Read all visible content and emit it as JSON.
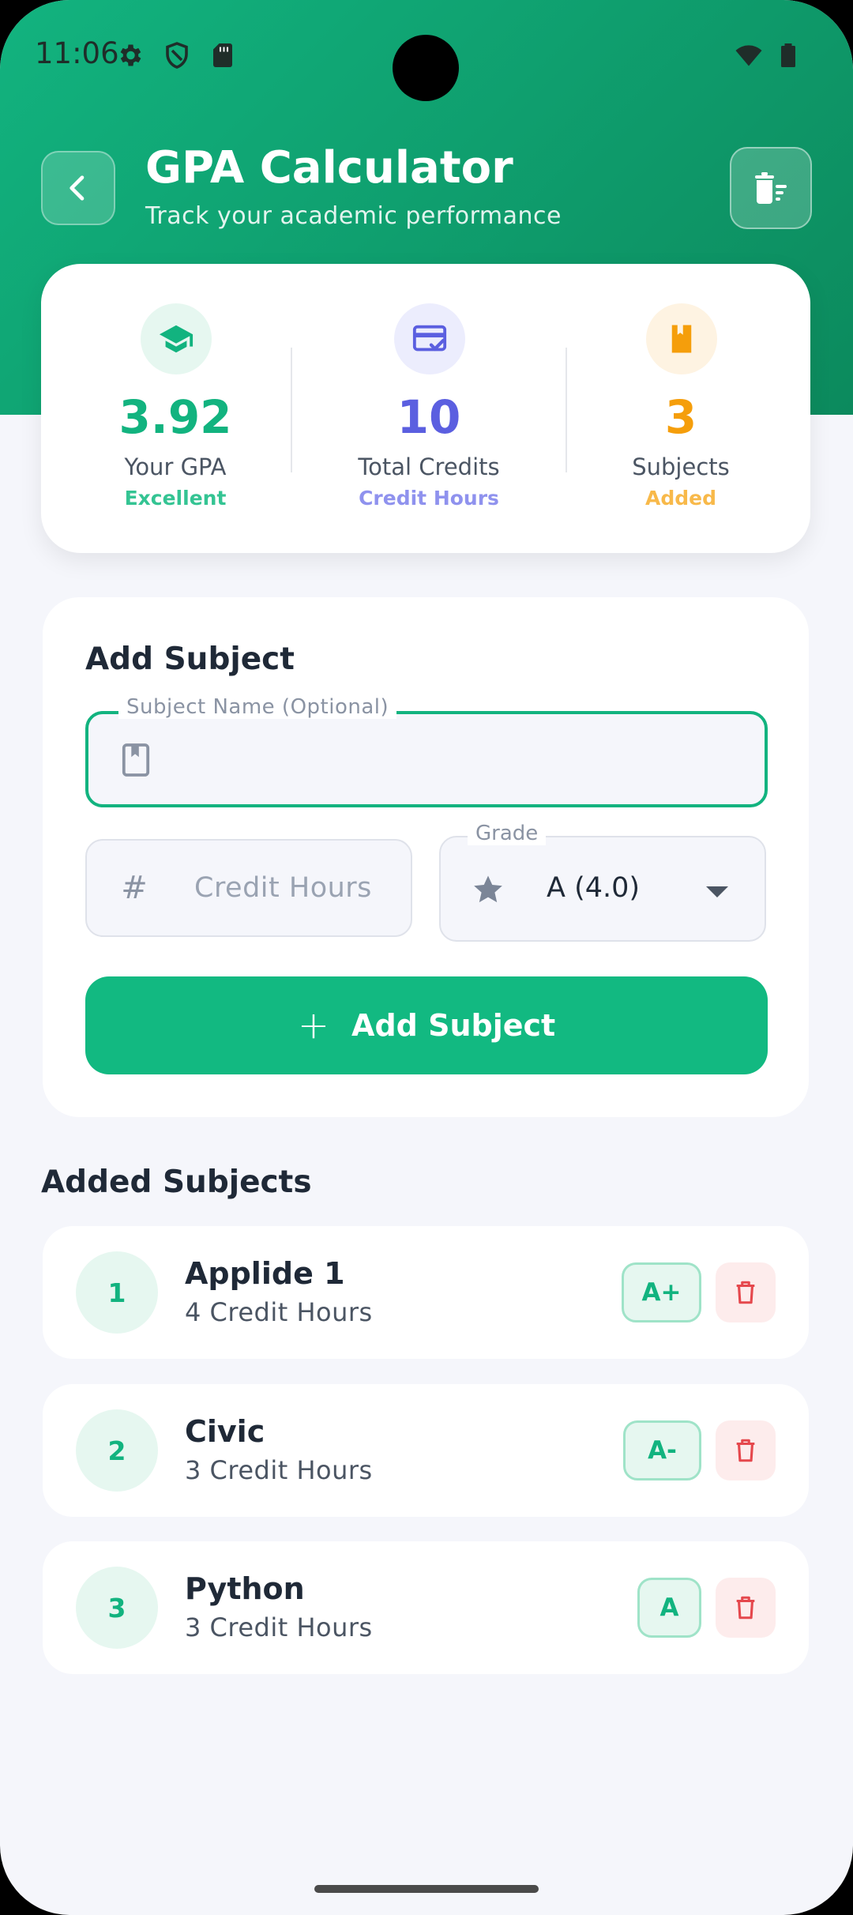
{
  "status_bar": {
    "time": "11:06",
    "icons": [
      "gear-icon",
      "shield-icon",
      "sd-card-icon",
      "wifi-icon",
      "battery-icon"
    ]
  },
  "header": {
    "title": "GPA Calculator",
    "subtitle": "Track your academic performance",
    "back_icon": "chevron-left-icon",
    "clear_icon": "clear-list-icon"
  },
  "stats": {
    "gpa": {
      "value": "3.92",
      "label": "Your GPA",
      "sub": "Excellent",
      "color": "#12b37f",
      "icon": "graduation-cap-icon"
    },
    "credits": {
      "value": "10",
      "label": "Total Credits",
      "sub": "Credit Hours",
      "color": "#5b5fe0",
      "sub_color": "#8f92ee",
      "icon": "credit-card-check-icon"
    },
    "subjects": {
      "value": "3",
      "label": "Subjects",
      "sub": "Added",
      "color": "#f59e0b",
      "sub_color": "#f8b94a",
      "icon": "book-icon"
    }
  },
  "add_form": {
    "title": "Add Subject",
    "subject_name_label": "Subject Name (Optional)",
    "subject_name_value": "",
    "credit_placeholder": "Credit Hours",
    "grade_label": "Grade",
    "grade_value": "A (4.0)",
    "add_button_label": "Add Subject"
  },
  "subjects_section": {
    "title": "Added Subjects",
    "items": [
      {
        "index": "1",
        "name": "Applide 1",
        "credits": "4 Credit Hours",
        "grade": "A+"
      },
      {
        "index": "2",
        "name": "Civic",
        "credits": "3 Credit Hours",
        "grade": "A-"
      },
      {
        "index": "3",
        "name": "Python",
        "credits": "3 Credit Hours",
        "grade": "A"
      }
    ]
  },
  "colors": {
    "accent": "#12b981",
    "header_gradient_start": "#12b37f",
    "header_gradient_end": "#0c8a5d",
    "delete": "#e5484d"
  }
}
